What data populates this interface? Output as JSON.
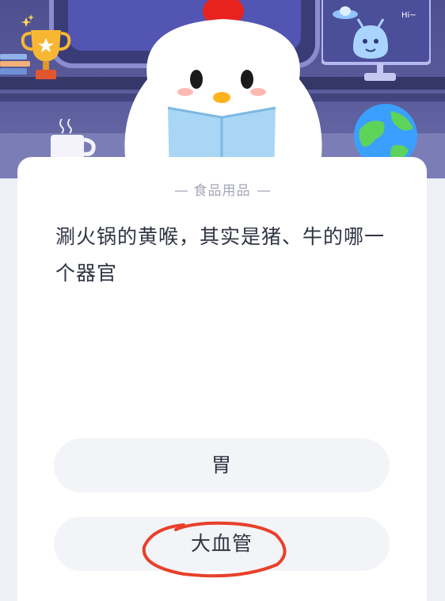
{
  "banner": {
    "frame_text": "Hi~"
  },
  "card": {
    "category": "食品用品",
    "question": "涮火锅的黄喉，其实是猪、牛的哪一个器官",
    "options": [
      {
        "label": "胃"
      },
      {
        "label": "大血管"
      }
    ]
  },
  "colors": {
    "banner_bg": "#5a5c9c",
    "card_bg": "#ffffff",
    "option_bg": "#f2f4f7",
    "annotation_red": "#e8402a"
  }
}
